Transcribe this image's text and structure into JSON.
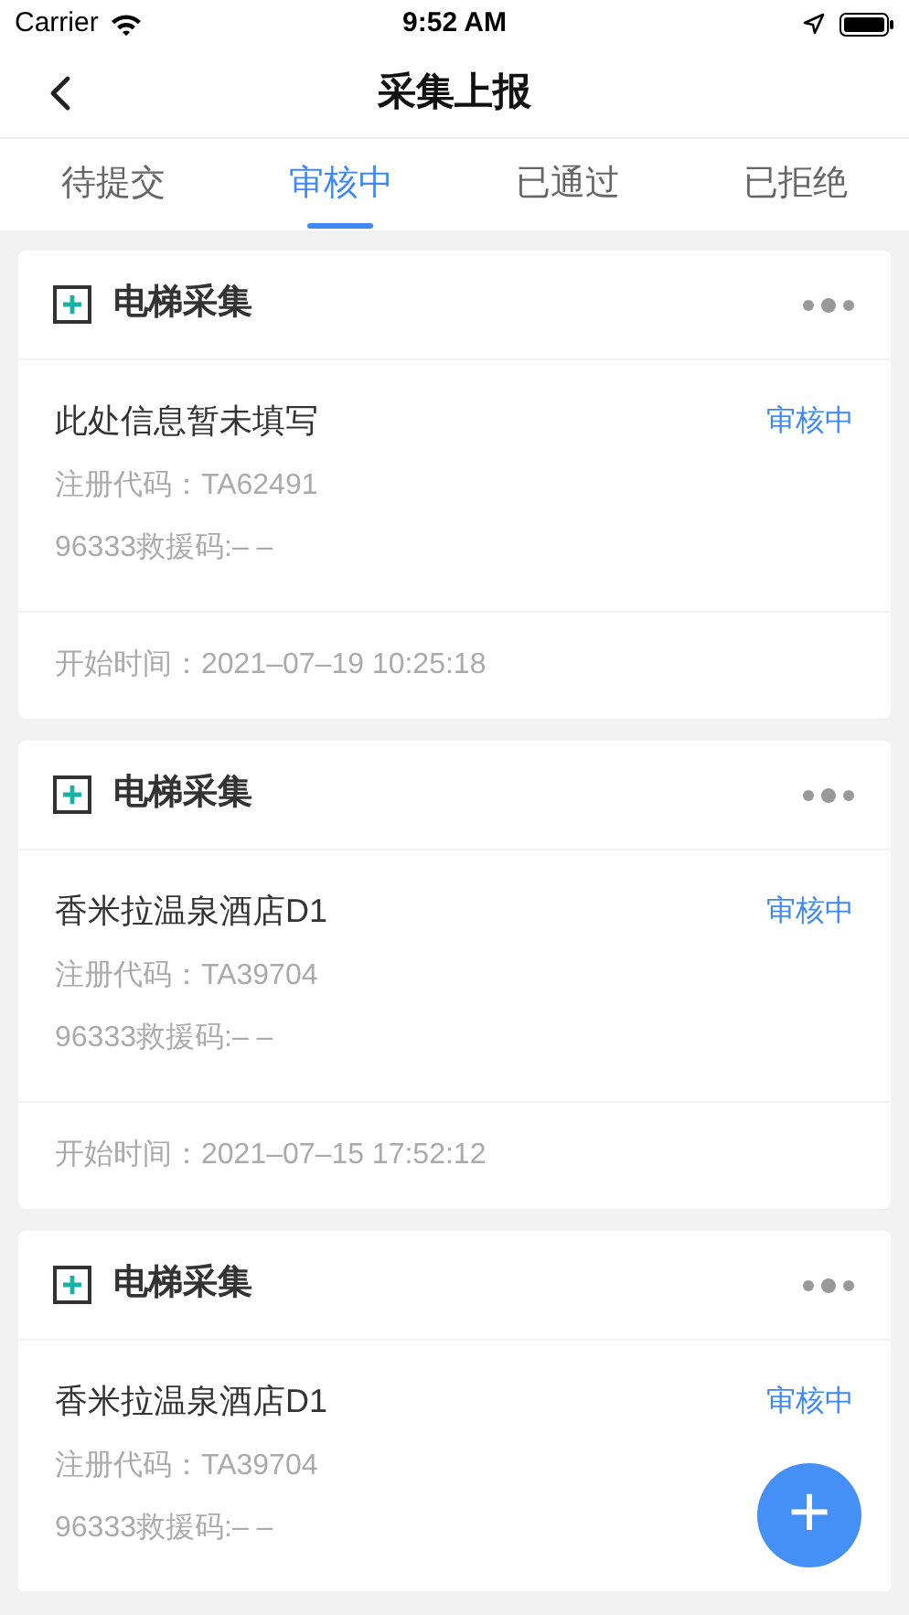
{
  "status_bar": {
    "carrier": "Carrier",
    "time": "9:52 AM"
  },
  "nav": {
    "title": "采集上报"
  },
  "tabs": [
    {
      "label": "待提交",
      "selected": false
    },
    {
      "label": "审核中",
      "selected": true
    },
    {
      "label": "已通过",
      "selected": false
    },
    {
      "label": "已拒绝",
      "selected": false
    }
  ],
  "cards": [
    {
      "title": "电梯采集",
      "name": "此处信息暂未填写",
      "status": "审核中",
      "reg_code": "注册代码：TA62491",
      "rescue_code": "96333救援码:– –",
      "start_time": "开始时间：2021–07–19 10:25:18"
    },
    {
      "title": "电梯采集",
      "name": "香米拉温泉酒店D1",
      "status": "审核中",
      "reg_code": "注册代码：TA39704",
      "rescue_code": "96333救援码:– –",
      "start_time": "开始时间：2021–07–15 17:52:12"
    },
    {
      "title": "电梯采集",
      "name": "香米拉温泉酒店D1",
      "status": "审核中",
      "reg_code": "注册代码：TA39704",
      "rescue_code": "96333救援码:– –"
    }
  ],
  "fab": {
    "label": "+"
  }
}
